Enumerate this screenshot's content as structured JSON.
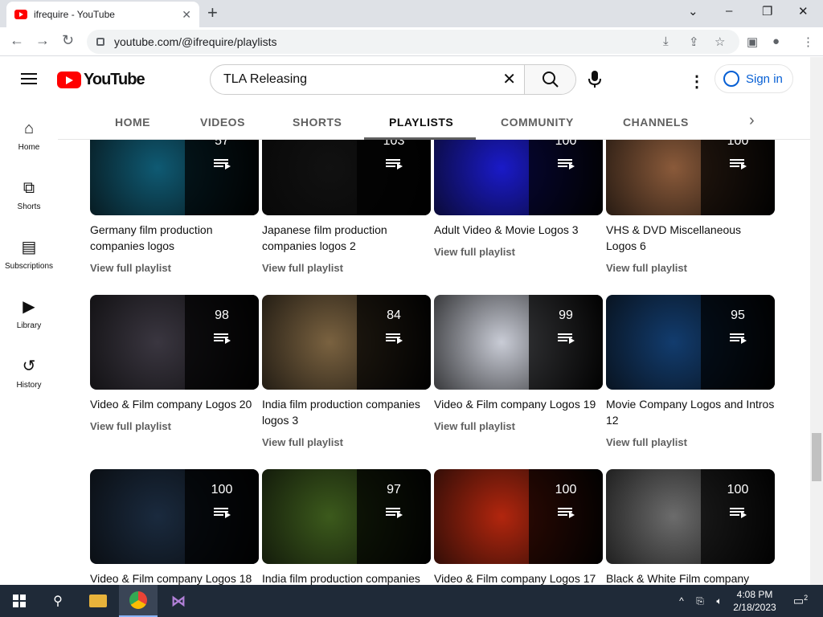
{
  "browser": {
    "tab_title": "ifrequire - YouTube",
    "url": "youtube.com/@ifrequire/playlists"
  },
  "masthead": {
    "logo_text": "YouTube",
    "search_value": "TLA Releasing",
    "signin_label": "Sign in"
  },
  "channel_tabs": [
    "HOME",
    "VIDEOS",
    "SHORTS",
    "PLAYLISTS",
    "COMMUNITY",
    "CHANNELS"
  ],
  "guide": {
    "items": [
      {
        "label": "Home",
        "icon": "home-icon"
      },
      {
        "label": "Shorts",
        "icon": "shorts-icon"
      },
      {
        "label": "Subscriptions",
        "icon": "subscriptions-icon"
      },
      {
        "label": "Library",
        "icon": "library-icon"
      },
      {
        "label": "History",
        "icon": "history-icon"
      }
    ]
  },
  "playlist_link_label": "View full playlist",
  "playlists": [
    {
      "title": "Germany film production companies logos",
      "count": "57",
      "color": "#0f5a73"
    },
    {
      "title": "Japanese film production companies logos 2",
      "count": "103",
      "color": "#111111"
    },
    {
      "title": "Adult Video & Movie Logos 3",
      "count": "100",
      "color": "#1a1ac8"
    },
    {
      "title": "VHS & DVD Miscellaneous Logos 6",
      "count": "100",
      "color": "#8a5a3a"
    },
    {
      "title": "Video & Film company Logos 20",
      "count": "98",
      "color": "#3a3640"
    },
    {
      "title": "India film production companies logos 3",
      "count": "84",
      "color": "#7a6240"
    },
    {
      "title": "Video & Film company Logos 19",
      "count": "99",
      "color": "#c9ccd6"
    },
    {
      "title": "Movie Company Logos and Intros 12",
      "count": "95",
      "color": "#123c6e"
    },
    {
      "title": "Video & Film company Logos 18",
      "count": "100",
      "color": "#1a2a3e"
    },
    {
      "title": "India film production companies",
      "count": "97",
      "color": "#3c5a1c"
    },
    {
      "title": "Video & Film company Logos 17",
      "count": "100",
      "color": "#b2260e"
    },
    {
      "title": "Black & White Film company",
      "count": "100",
      "color": "#6c6c6c"
    }
  ],
  "taskbar": {
    "time": "4:08 PM",
    "date": "2/18/2023",
    "notifications": "2"
  }
}
